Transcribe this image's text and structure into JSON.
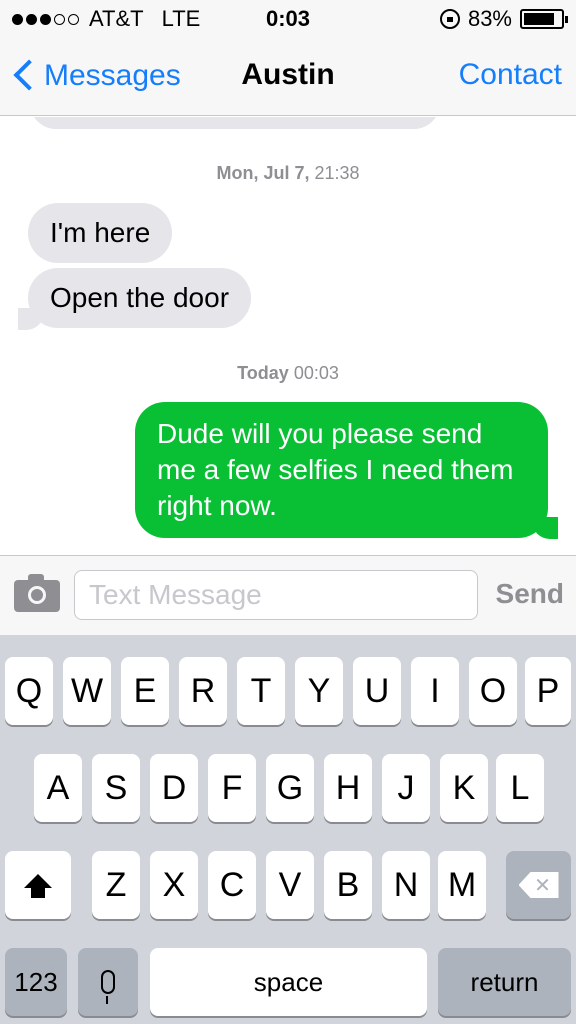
{
  "status_bar": {
    "carrier": "AT&T",
    "network": "LTE",
    "time": "0:03",
    "battery_percent": "83%",
    "battery_level": 0.83,
    "signal_bars_filled": 3,
    "signal_bars_total": 5
  },
  "nav": {
    "back_label": "Messages",
    "title": "Austin",
    "contact_label": "Contact",
    "accent_color": "#157efb"
  },
  "thread": {
    "timestamps": [
      {
        "day": "Mon, Jul 7,",
        "time": "21:38"
      },
      {
        "day": "Today",
        "time": "00:03"
      }
    ],
    "messages": [
      {
        "direction": "incoming",
        "text": "I'm here"
      },
      {
        "direction": "incoming",
        "text": "Open the door"
      },
      {
        "direction": "outgoing",
        "text": "Dude will you please send me a few selfies I need them right now."
      }
    ],
    "incoming_color": "#e5e5ea",
    "outgoing_color": "#09c035"
  },
  "composer": {
    "placeholder": "Text Message",
    "value": "",
    "send_label": "Send",
    "camera_icon": "camera-icon"
  },
  "keyboard": {
    "row1": [
      "Q",
      "W",
      "E",
      "R",
      "T",
      "Y",
      "U",
      "I",
      "O",
      "P"
    ],
    "row2": [
      "A",
      "S",
      "D",
      "F",
      "G",
      "H",
      "J",
      "K",
      "L"
    ],
    "row3": [
      "Z",
      "X",
      "C",
      "V",
      "B",
      "N",
      "M"
    ],
    "numbers_label": "123",
    "space_label": "space",
    "return_label": "return"
  }
}
